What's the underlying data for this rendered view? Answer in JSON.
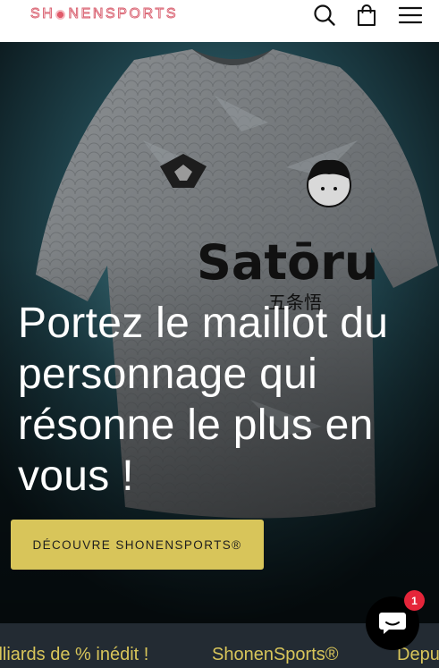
{
  "header": {
    "logo_text_before": "SH",
    "logo_text_after": "NENSPORTS",
    "icons": [
      "search-icon",
      "shopping-bag-icon",
      "hamburger-menu-icon"
    ]
  },
  "hero": {
    "heading": "Portez le maillot du personnage qui résonne le plus en vous !",
    "cta_label": "DÉCOUVRE SHONENSPORTS®",
    "jersey_text": "Satōru",
    "jersey_kanji": "五条悟"
  },
  "ticker": {
    "items": [
      "illiards de % inédit !",
      "ShonenSports®",
      "Depu"
    ]
  },
  "chat": {
    "badge_count": "1",
    "icon": "chat-bubble-icon"
  },
  "colors": {
    "accent": "#d8c55a",
    "logo": "#d85c6c",
    "ticker_bg": "#232b33",
    "badge": "#e5253a"
  }
}
